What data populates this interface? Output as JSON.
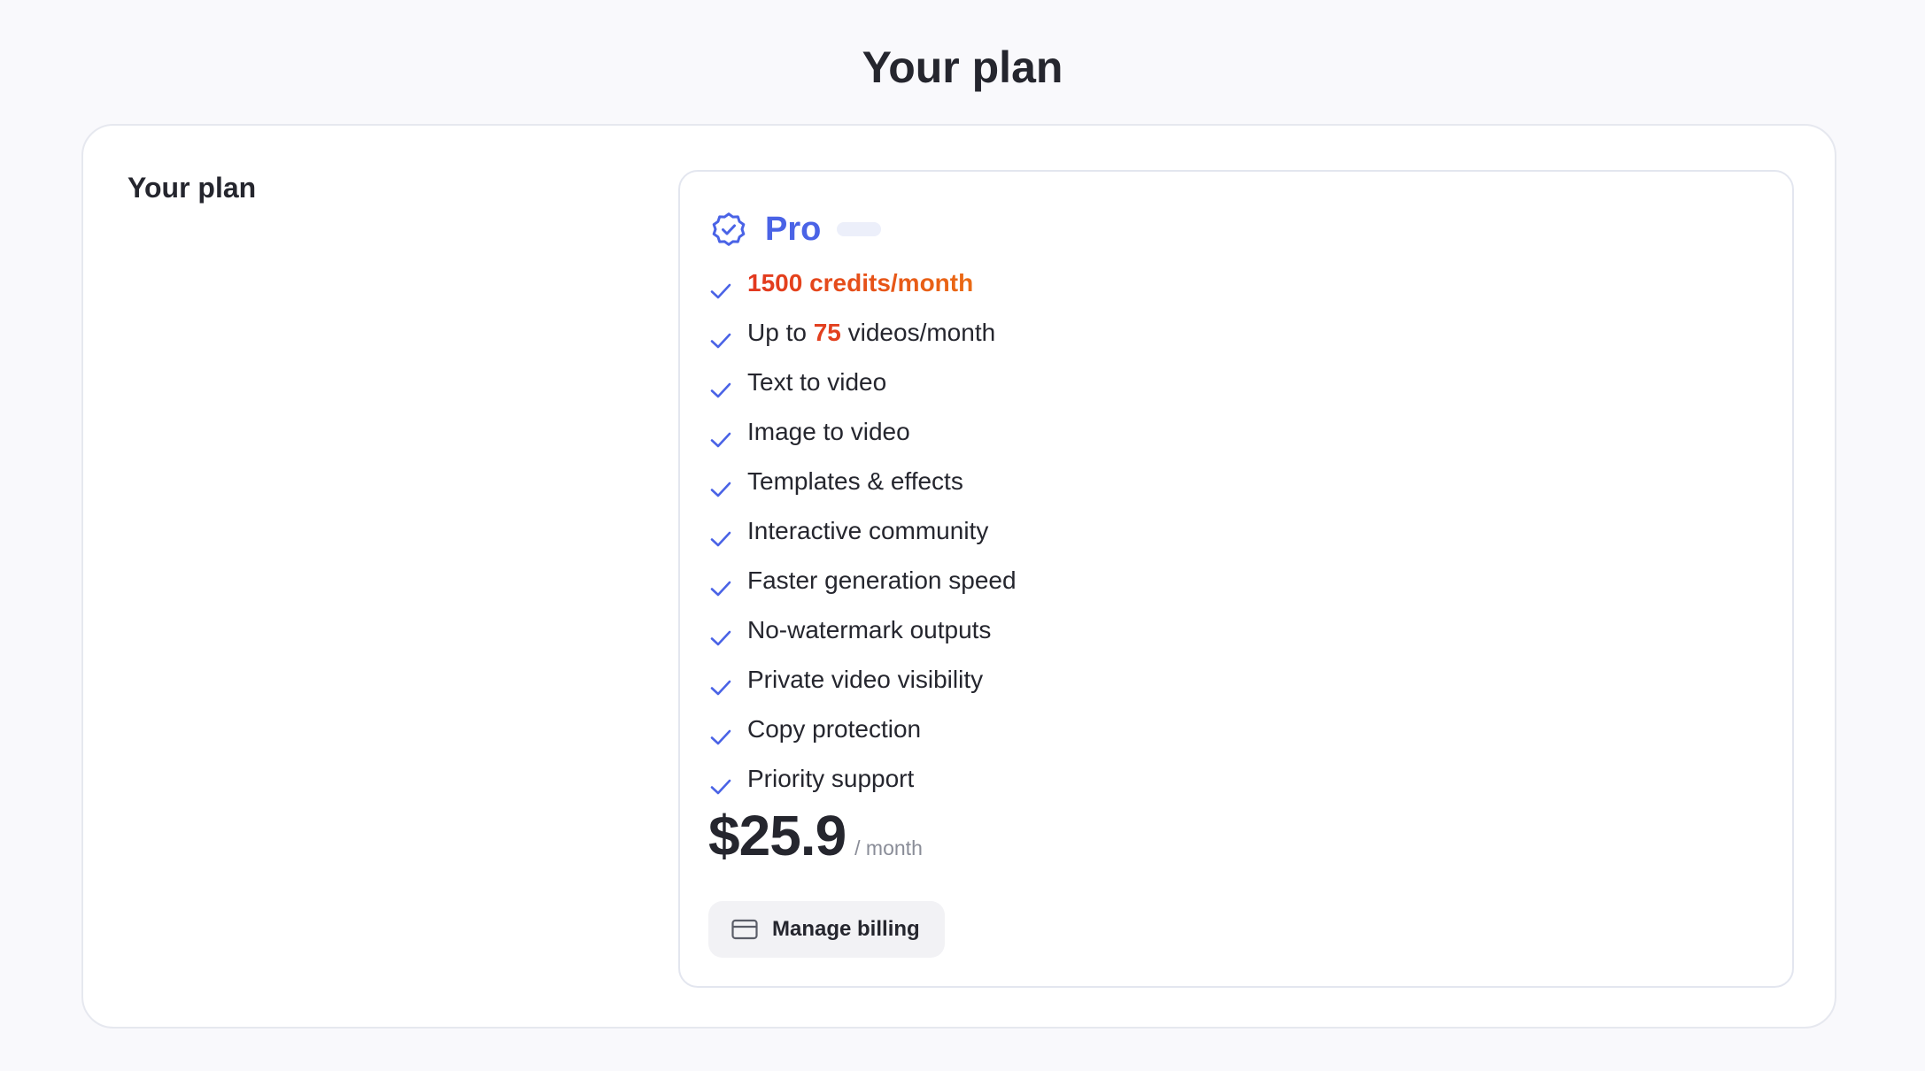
{
  "page": {
    "title": "Your plan"
  },
  "section": {
    "label": "Your plan"
  },
  "plan": {
    "badge_icon": "verified-badge-icon",
    "name": "Pro",
    "accent_color": "#4a63e6",
    "features": [
      {
        "text": "1500 credits/month",
        "icon": "check-icon"
      },
      {
        "prefix": "Up to ",
        "highlight": "75",
        "suffix": " videos/month",
        "icon": "check-icon"
      },
      {
        "text": "Text to video",
        "icon": "check-icon"
      },
      {
        "text": "Image to video",
        "icon": "check-icon"
      },
      {
        "text": "Templates & effects",
        "icon": "check-icon"
      },
      {
        "text": "Interactive community",
        "icon": "check-icon"
      },
      {
        "text": "Faster generation speed",
        "icon": "check-icon"
      },
      {
        "text": "No-watermark outputs",
        "icon": "check-icon"
      },
      {
        "text": "Private video visibility",
        "icon": "check-icon"
      },
      {
        "text": "Copy protection",
        "icon": "check-icon"
      },
      {
        "text": "Priority support",
        "icon": "check-icon"
      }
    ],
    "price": "$25.9",
    "period": "/ month"
  },
  "billing": {
    "label": "Manage billing",
    "icon": "credit-card-icon"
  },
  "colors": {
    "background": "#f9f9fc",
    "card": "#ffffff",
    "highlight": "#e2401f",
    "credits_gradient": [
      "#e2371f",
      "#ea6a14"
    ]
  }
}
